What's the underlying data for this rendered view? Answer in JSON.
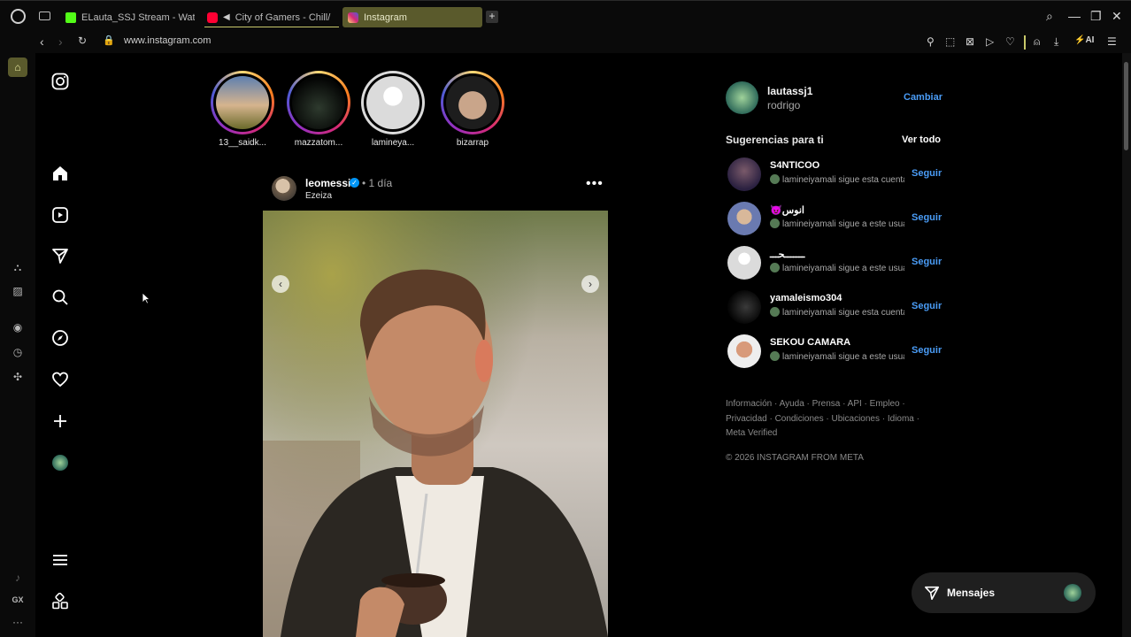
{
  "browser": {
    "tabs": [
      {
        "label": "ELauta_SSJ Stream - Watc",
        "icon": "kick-icon",
        "active": false
      },
      {
        "label": "City of Gamers - Chill/",
        "icon": "youtube-icon",
        "active": false
      },
      {
        "label": "Instagram",
        "icon": "instagram-icon",
        "active": true
      }
    ],
    "new_tab": "+",
    "url": "www.instagram.com",
    "sidebar_bottom_label": "GX",
    "sidebar_more": "···"
  },
  "stories": [
    {
      "name": "13__saidk..."
    },
    {
      "name": "mazzatom..."
    },
    {
      "name": "lamineya..."
    },
    {
      "name": "bizarrap"
    }
  ],
  "post": {
    "username": "leomessi",
    "verified_mark": "✓",
    "time": "• 1 día",
    "location": "Ezeiza",
    "more": "•••",
    "prev": "‹",
    "next": "›"
  },
  "account": {
    "username": "lautassj1",
    "name": "rodrigo",
    "switch_label": "Cambiar"
  },
  "suggestions": {
    "title": "Sugerencias para ti",
    "see_all": "Ver todo",
    "follow_label": "Seguir",
    "items": [
      {
        "username": "S4NTICOO",
        "subtitle": "lamineiyamali sigue esta cuenta"
      },
      {
        "username": "😈انوس",
        "subtitle": "lamineiyamali sigue a este usuario"
      },
      {
        "username": "ـــــــحـــ",
        "subtitle": "lamineiyamali sigue a este usuario"
      },
      {
        "username": "yamaleismo304",
        "subtitle": "lamineiyamali sigue esta cuenta"
      },
      {
        "username": "SEKOU CAMARA",
        "subtitle": "lamineiyamali sigue a este usuario"
      }
    ]
  },
  "footer": {
    "links": "Información · Ayuda · Prensa · API · Empleo · Privacidad · Condiciones · Ubicaciones · Idioma · Meta Verified",
    "copyright": "© 2026 INSTAGRAM FROM META"
  },
  "messages": {
    "label": "Mensajes"
  }
}
